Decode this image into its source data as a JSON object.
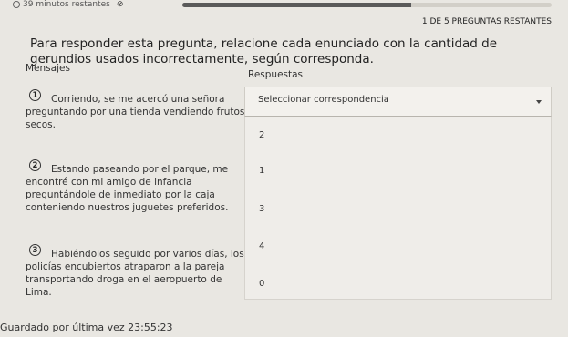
{
  "header": {
    "timer_text": "39 minutos restantes",
    "progress_fraction": 0.62,
    "remaining_questions": "1 DE 5 PREGUNTAS RESTANTES"
  },
  "question": {
    "prompt": "Para responder esta pregunta, relacione cada enunciado con la cantidad de gerundios usados incorrectamente, según corresponda."
  },
  "columns": {
    "messages_label": "Mensajes",
    "answers_label": "Respuestas"
  },
  "statements": [
    {
      "number": "1",
      "text": "Corriendo, se me acercó una señora preguntando por una tienda vendiendo frutos secos."
    },
    {
      "number": "2",
      "text": "Estando paseando por el parque, me encontré con mi amigo de infancia preguntándole de inmediato por la caja conteniendo nuestros juguetes preferidos."
    },
    {
      "number": "3",
      "text": "Habiéndolos seguido por varios días, los policías encubiertos atraparon a la pareja transportando droga en el aeropuerto de Lima."
    }
  ],
  "dropdown": {
    "placeholder": "Seleccionar correspondencia",
    "options": [
      "2",
      "1",
      "3",
      "4",
      "0"
    ]
  },
  "footer": {
    "saved_text": "Guardado por última vez 23:55:23"
  }
}
